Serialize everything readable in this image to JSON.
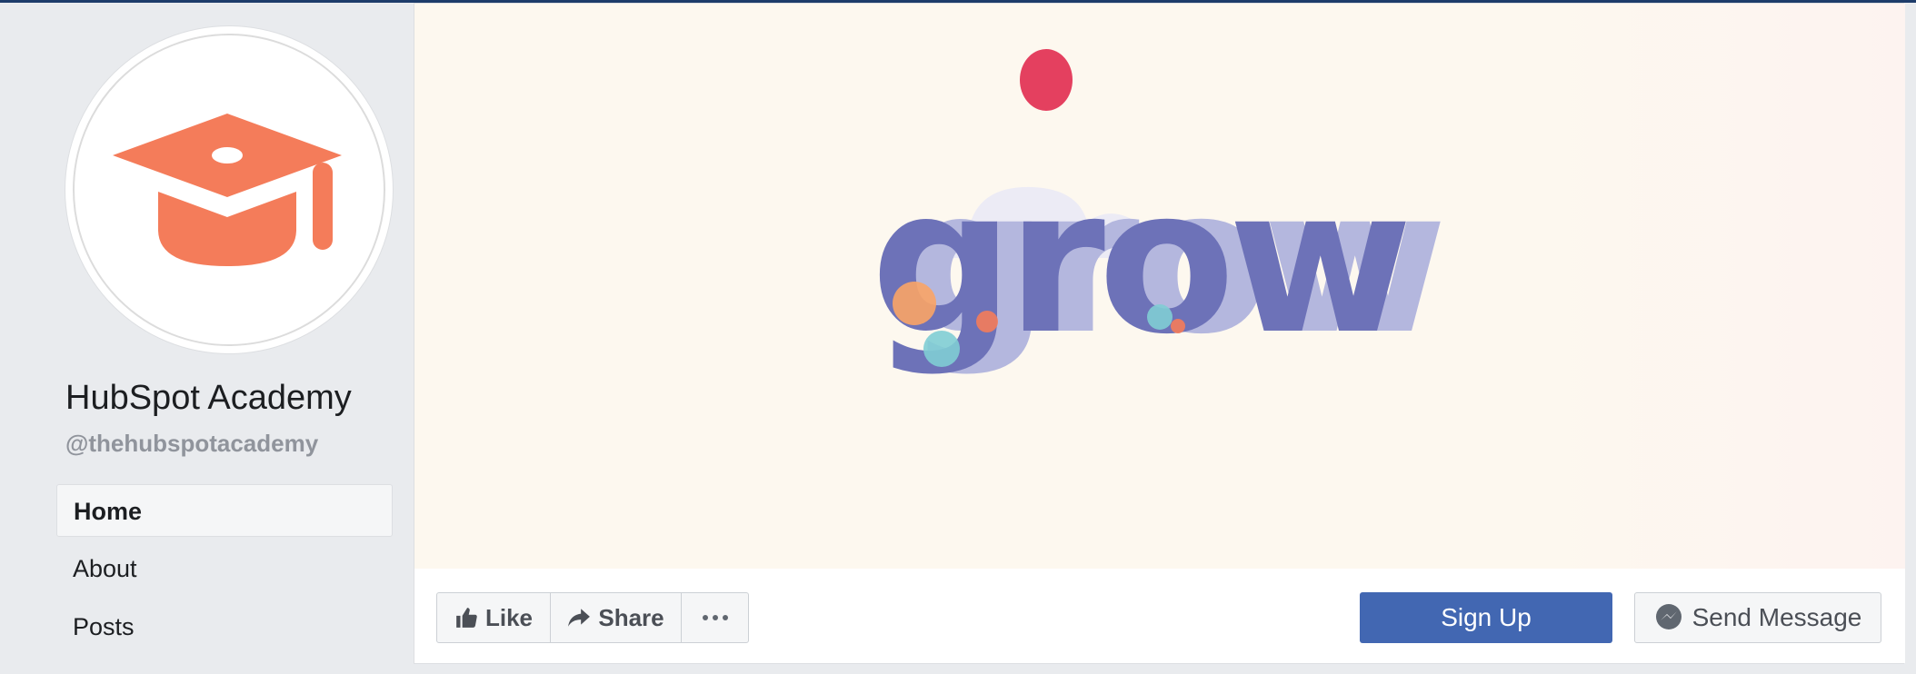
{
  "page": {
    "name": "HubSpot Academy",
    "handle": "@thehubspotacademy"
  },
  "nav": {
    "items": [
      {
        "label": "Home",
        "active": true
      },
      {
        "label": "About",
        "active": false
      },
      {
        "label": "Posts",
        "active": false
      }
    ]
  },
  "cover": {
    "word": "grow"
  },
  "actions": {
    "like_label": "Like",
    "share_label": "Share",
    "signup_label": "Sign Up",
    "send_message_label": "Send Message"
  },
  "icons": {
    "avatar": "graduation-cap-icon",
    "like": "thumbs-up-icon",
    "share": "share-arrow-icon",
    "more": "ellipsis-icon",
    "messenger": "messenger-icon"
  },
  "colors": {
    "brand_blue": "#4267b2",
    "hubspot_orange": "#f47c5a",
    "grow_purple": "#6d72b8",
    "cover_bg": "#fdf8ef",
    "page_bg": "#e9ebee"
  }
}
